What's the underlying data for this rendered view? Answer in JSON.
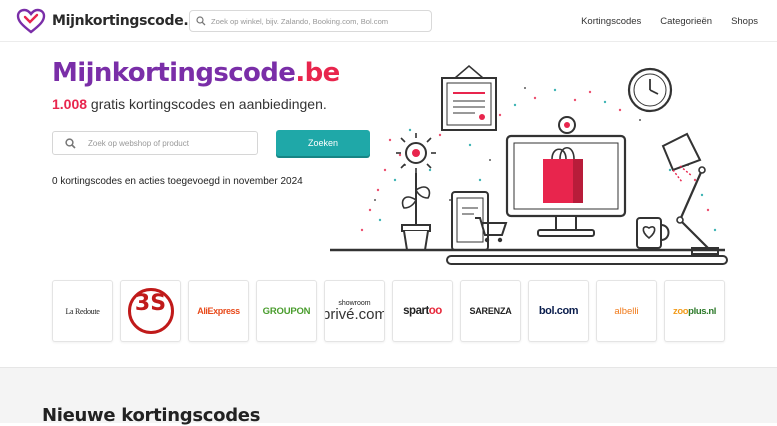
{
  "header": {
    "logo_text": "Mijnkortingscode.be",
    "search_placeholder": "Zoek op winkel, bijv. Zalando, Booking.com, Bol.com",
    "nav": [
      {
        "label": "Kortingscodes"
      },
      {
        "label": "Categorieën"
      },
      {
        "label": "Shops"
      }
    ]
  },
  "hero": {
    "title_main": "Mijnkortingscode",
    "title_tld": ".be",
    "subtitle_count": "1.008",
    "subtitle_rest": " gratis kortingscodes en aanbiedingen.",
    "search_placeholder": "Zoek op webshop of product",
    "search_button": "Zoeken",
    "added_text": "0 kortingscodes en acties toegevoegd in november 2024"
  },
  "shops": [
    {
      "name": "La Redoute"
    },
    {
      "name": "3S"
    },
    {
      "name": "AliExpress"
    },
    {
      "name": "GROUPON"
    },
    {
      "name_top": "showroom",
      "name_bottom": "privé.com"
    },
    {
      "name_a": "spart",
      "name_b": "oo"
    },
    {
      "name": "SARENZA"
    },
    {
      "name": "bol.com"
    },
    {
      "name": "albelli"
    },
    {
      "name_a": "zoo",
      "name_b": "plus.nl"
    }
  ],
  "sections": {
    "new_codes_title": "Nieuwe kortingscodes"
  },
  "colors": {
    "brand_purple": "#7a2ea8",
    "accent_red": "#e8254d",
    "button_teal": "#1fa8a8"
  }
}
